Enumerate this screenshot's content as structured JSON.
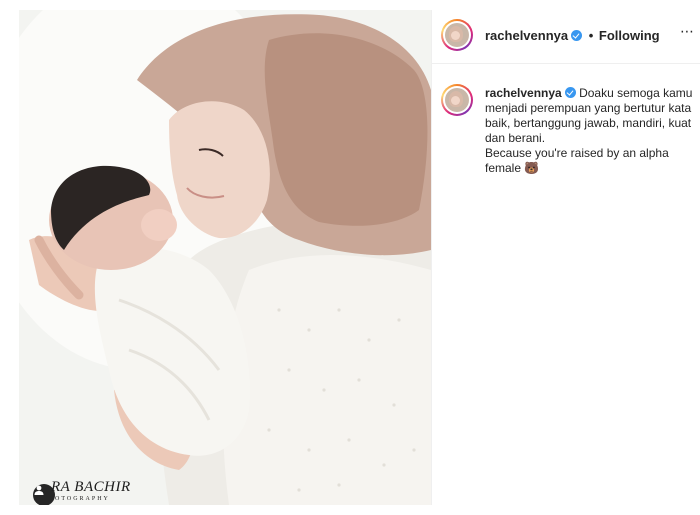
{
  "post": {
    "username": "rachelvennya",
    "verified": true,
    "follow_status": "Following",
    "separator": "•",
    "more_icon": "more-options-icon",
    "caption": {
      "username": "rachelvennya",
      "text": "Doaku semoga kamu menjadi perempuan yang bertutur kata baik, bertanggung jawab, mandiri, kuat dan berani.\nBecause you're raised by an alpha female 🐻"
    },
    "photo": {
      "watermark_name": "RA BACHIR",
      "watermark_sub": "OTOGRAPHY",
      "tag_icon": "user-tag-icon"
    }
  },
  "colors": {
    "verified": "#3897f0",
    "hijab": "#c9a797",
    "text": "#262626"
  }
}
